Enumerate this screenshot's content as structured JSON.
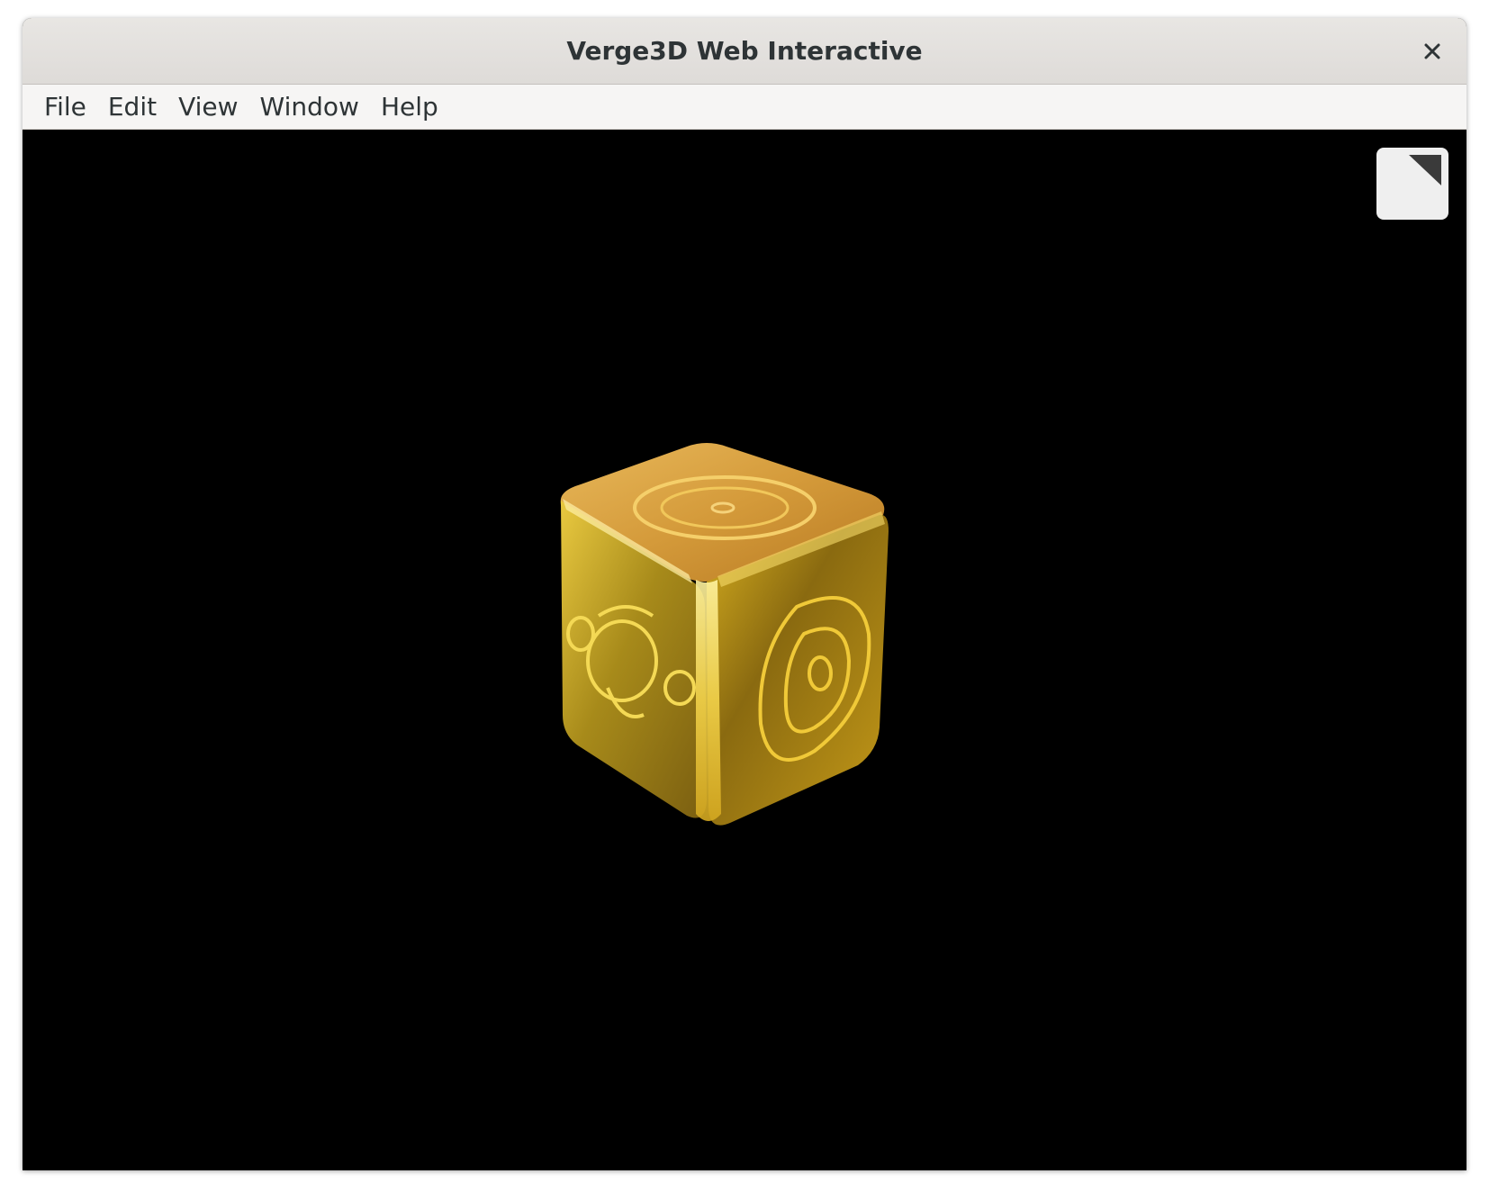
{
  "window": {
    "title": "Verge3D Web Interactive",
    "close_glyph": "✕"
  },
  "menubar": {
    "items": [
      {
        "label": "File"
      },
      {
        "label": "Edit"
      },
      {
        "label": "View"
      },
      {
        "label": "Window"
      },
      {
        "label": "Help"
      }
    ]
  },
  "viewport": {
    "background": "#000000",
    "object": "gold-cube-icon",
    "object_color": "#c9a227",
    "fullscreen_icon": "fullscreen-icon"
  }
}
